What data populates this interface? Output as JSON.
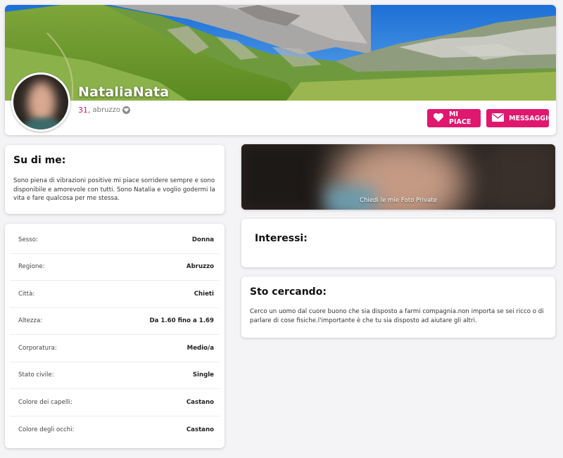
{
  "profile": {
    "username": "NataliaNata",
    "age": "31,",
    "region": "abruzzo"
  },
  "actions": {
    "like_label": "MI PIACE",
    "message_label": "MESSAGGIO"
  },
  "about": {
    "title": "Su di me:",
    "text": "Sono piena di vibrazioni positive mi piace sorridere sempre e sono disponibile e amorevole con tutti. Sono Natalia e voglio godermi la vita e fare qualcosa per me stessa."
  },
  "details": [
    {
      "label": "Sesso:",
      "value": "Donna"
    },
    {
      "label": "Regione:",
      "value": "Abruzzo"
    },
    {
      "label": "Città:",
      "value": "Chieti"
    },
    {
      "label": "Altezza:",
      "value": "Da 1.60 fino a 1.69"
    },
    {
      "label": "Corporatura:",
      "value": "Medio/a"
    },
    {
      "label": "Stato civile:",
      "value": "Single"
    },
    {
      "label": "Colore dei capelli:",
      "value": "Castano"
    },
    {
      "label": "Colore degli occhi:",
      "value": "Castano"
    }
  ],
  "private_photos": {
    "label": "Chiedi le mie Foto Private"
  },
  "interests": {
    "title": "Interessi:"
  },
  "looking_for": {
    "title": "Sto cercando:",
    "text": "Cerco un uomo dal cuore buono che sia disposto a farmi compagnia.non importa se sei ricco o di parlare di cose fisiche.l'importante è che tu sia disposto ad aiutare gli altri."
  },
  "colors": {
    "accent": "#e0176f",
    "age": "#d81b72"
  },
  "icons": {
    "like": "heart-icon",
    "message": "envelope-icon",
    "region_badge": "heart-badge-icon"
  }
}
